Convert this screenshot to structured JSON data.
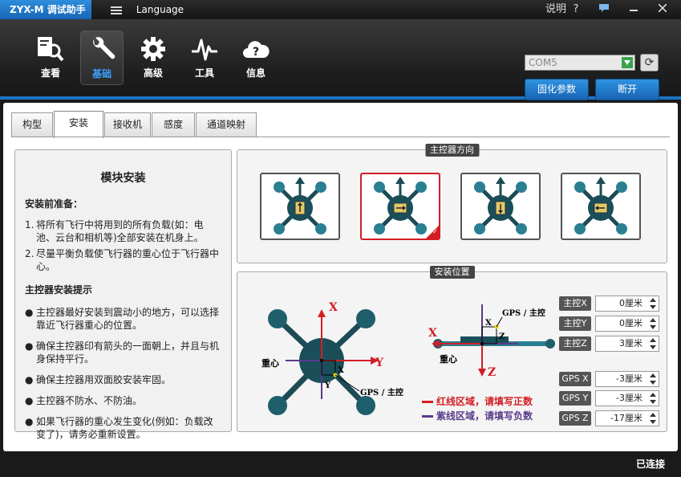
{
  "app": {
    "title": "ZYX-M 调试助手",
    "language": "Language",
    "help": "说明",
    "help_icon": "?"
  },
  "nav": [
    {
      "label": "查看",
      "icon": "magnifier-doc-icon",
      "active": false
    },
    {
      "label": "基础",
      "icon": "wrench-icon",
      "active": true
    },
    {
      "label": "高级",
      "icon": "gear-icon",
      "active": false
    },
    {
      "label": "工具",
      "icon": "pulse-icon",
      "active": false
    },
    {
      "label": "信息",
      "icon": "info-cloud-icon",
      "active": false
    }
  ],
  "connection": {
    "port": "COM5",
    "save_label": "固化参数",
    "open_label": "断开"
  },
  "tabs": [
    {
      "label": "构型",
      "active": false
    },
    {
      "label": "安装",
      "active": true
    },
    {
      "label": "接收机",
      "active": false
    },
    {
      "label": "感度",
      "active": false
    },
    {
      "label": "通道映射",
      "active": false
    }
  ],
  "instructions": {
    "title": "模块安装",
    "prep_heading": "安装前准备：",
    "prep_items": [
      {
        "marker": "1.",
        "text": "将所有飞行中将用到的所有负载(如：电池、云台和相机等)全部安装在机身上。"
      },
      {
        "marker": "2.",
        "text": "尽量平衡负载使飞行器的重心位于飞行器中心。"
      }
    ],
    "tips_heading": "主控器安装提示",
    "tips": [
      "主控器最好安装到震动小的地方，可以选择靠近飞行器重心的位置。",
      "确保主控器印有箭头的一面朝上，并且与机身保持平行。",
      "确保主控器用双面胶安装牢固。",
      "主控器不防水、不防油。",
      "如果飞行器的重心发生变化(例如：负载改变了)，请务必重新设置。"
    ]
  },
  "orientation": {
    "title": "主控器方向",
    "selected_index": 1
  },
  "position": {
    "title": "安装位置",
    "diagram": {
      "x": "X",
      "y": "Y",
      "z": "Z",
      "center": "重心",
      "gps_main": "GPS / 主控",
      "legend_red": "红线区域，请填写正数",
      "legend_purple": "紫线区域，请填写负数"
    },
    "fields": [
      {
        "label": "主控X",
        "value": "0厘米"
      },
      {
        "label": "主控Y",
        "value": "0厘米"
      },
      {
        "label": "主控Z",
        "value": "3厘米"
      },
      {
        "label": "GPS X",
        "value": "-3厘米"
      },
      {
        "label": "GPS Y",
        "value": "-3厘米"
      },
      {
        "label": "GPS Z",
        "value": "-17厘米"
      }
    ]
  },
  "status": {
    "text": "已连接"
  },
  "colors": {
    "accent": "#1a74c4",
    "positive": "#d31e25",
    "negative": "#5a3a8a"
  }
}
